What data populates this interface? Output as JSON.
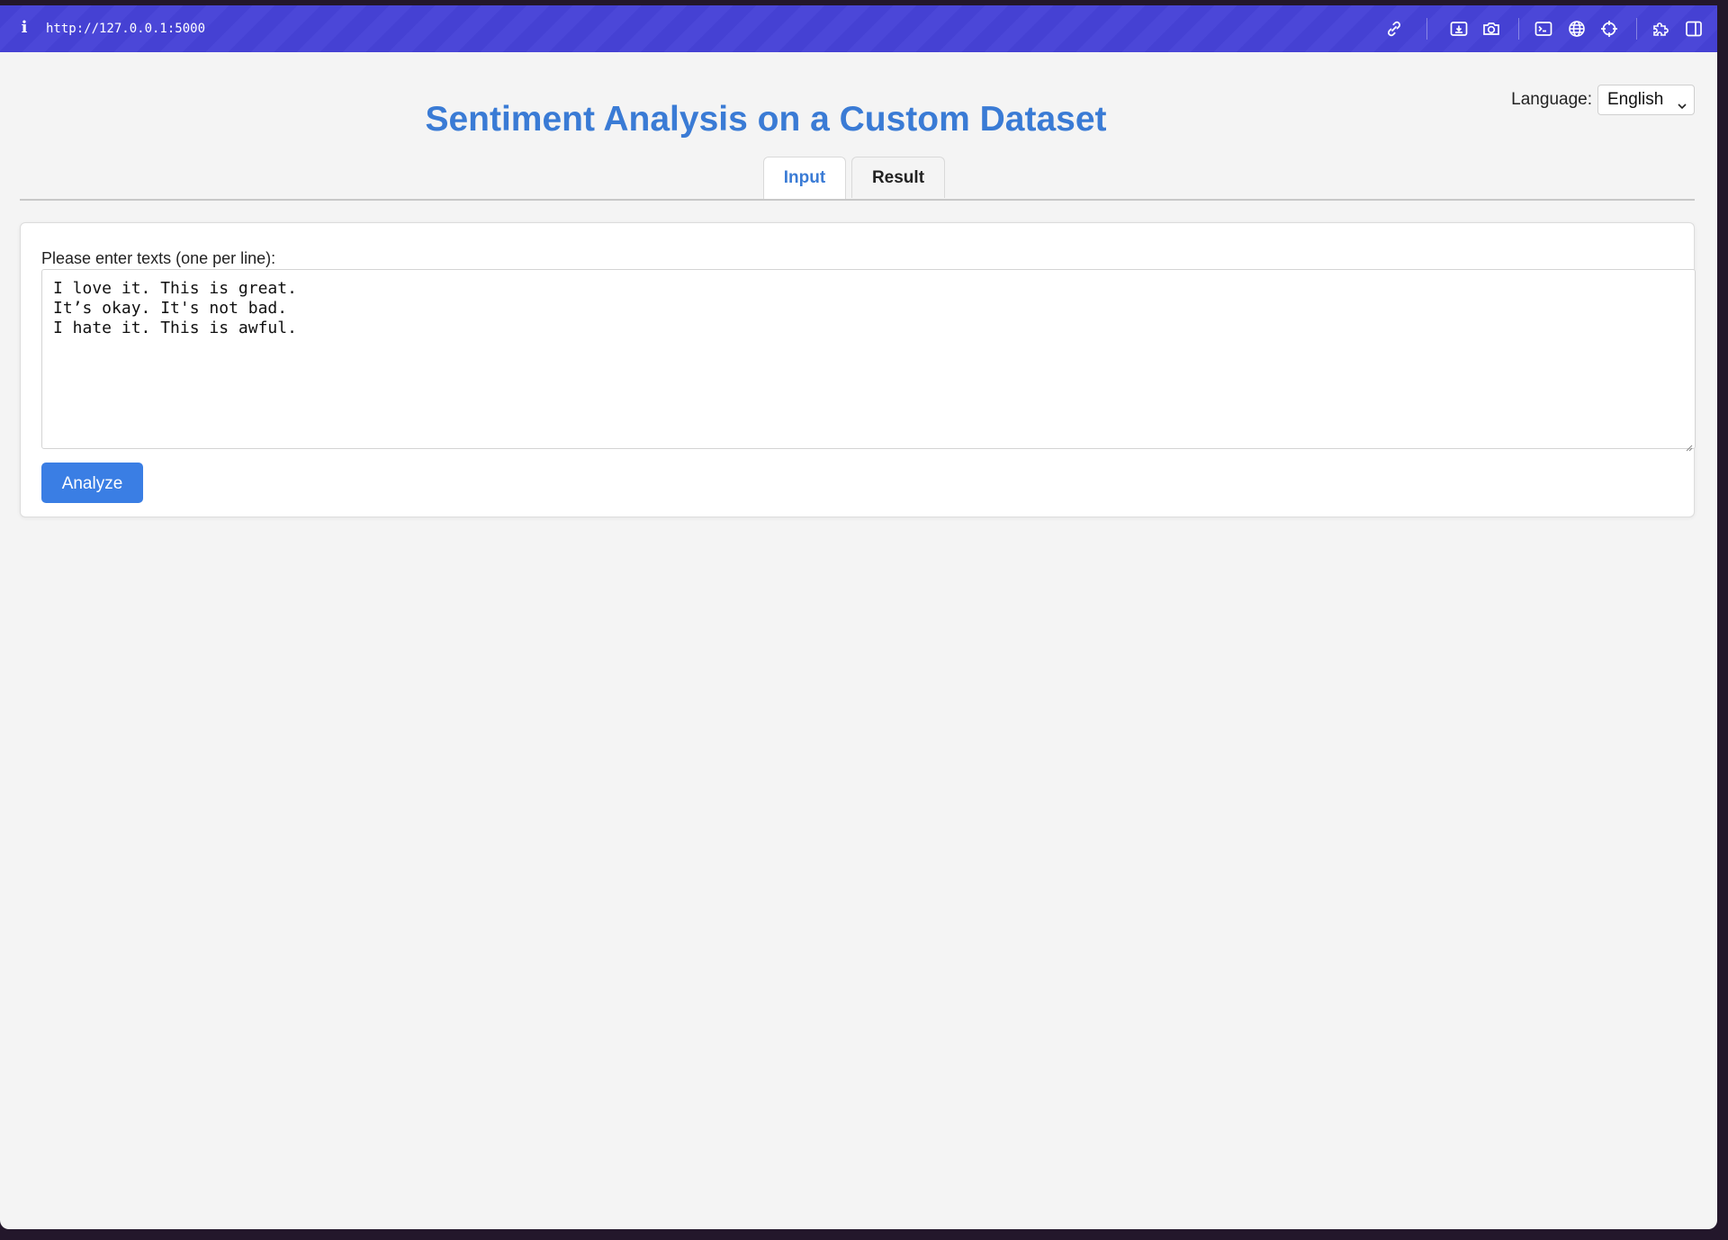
{
  "browser": {
    "url": "http://127.0.0.1:5000",
    "info_icon_glyph": "i",
    "toolbar_icons": [
      "link-icon",
      "screenshot-area-icon",
      "camera-icon",
      "terminal-icon",
      "globe-icon",
      "crosshair-icon",
      "extensions-icon",
      "split-view-icon"
    ]
  },
  "language": {
    "label": "Language:",
    "selected": "English"
  },
  "header": {
    "title": "Sentiment Analysis on a Custom Dataset"
  },
  "tabs": [
    {
      "label": "Input",
      "active": true
    },
    {
      "label": "Result",
      "active": false
    }
  ],
  "form": {
    "label": "Please enter texts (one per line):",
    "textarea_value": "I love it. This is great.\nIt’s okay. It's not bad.\nI hate it. This is awful.",
    "submit_label": "Analyze"
  },
  "colors": {
    "accent": "#3a7bd5",
    "button": "#3a7ee4",
    "toolbar": "#4541d3",
    "background": "#f4f4f4"
  }
}
